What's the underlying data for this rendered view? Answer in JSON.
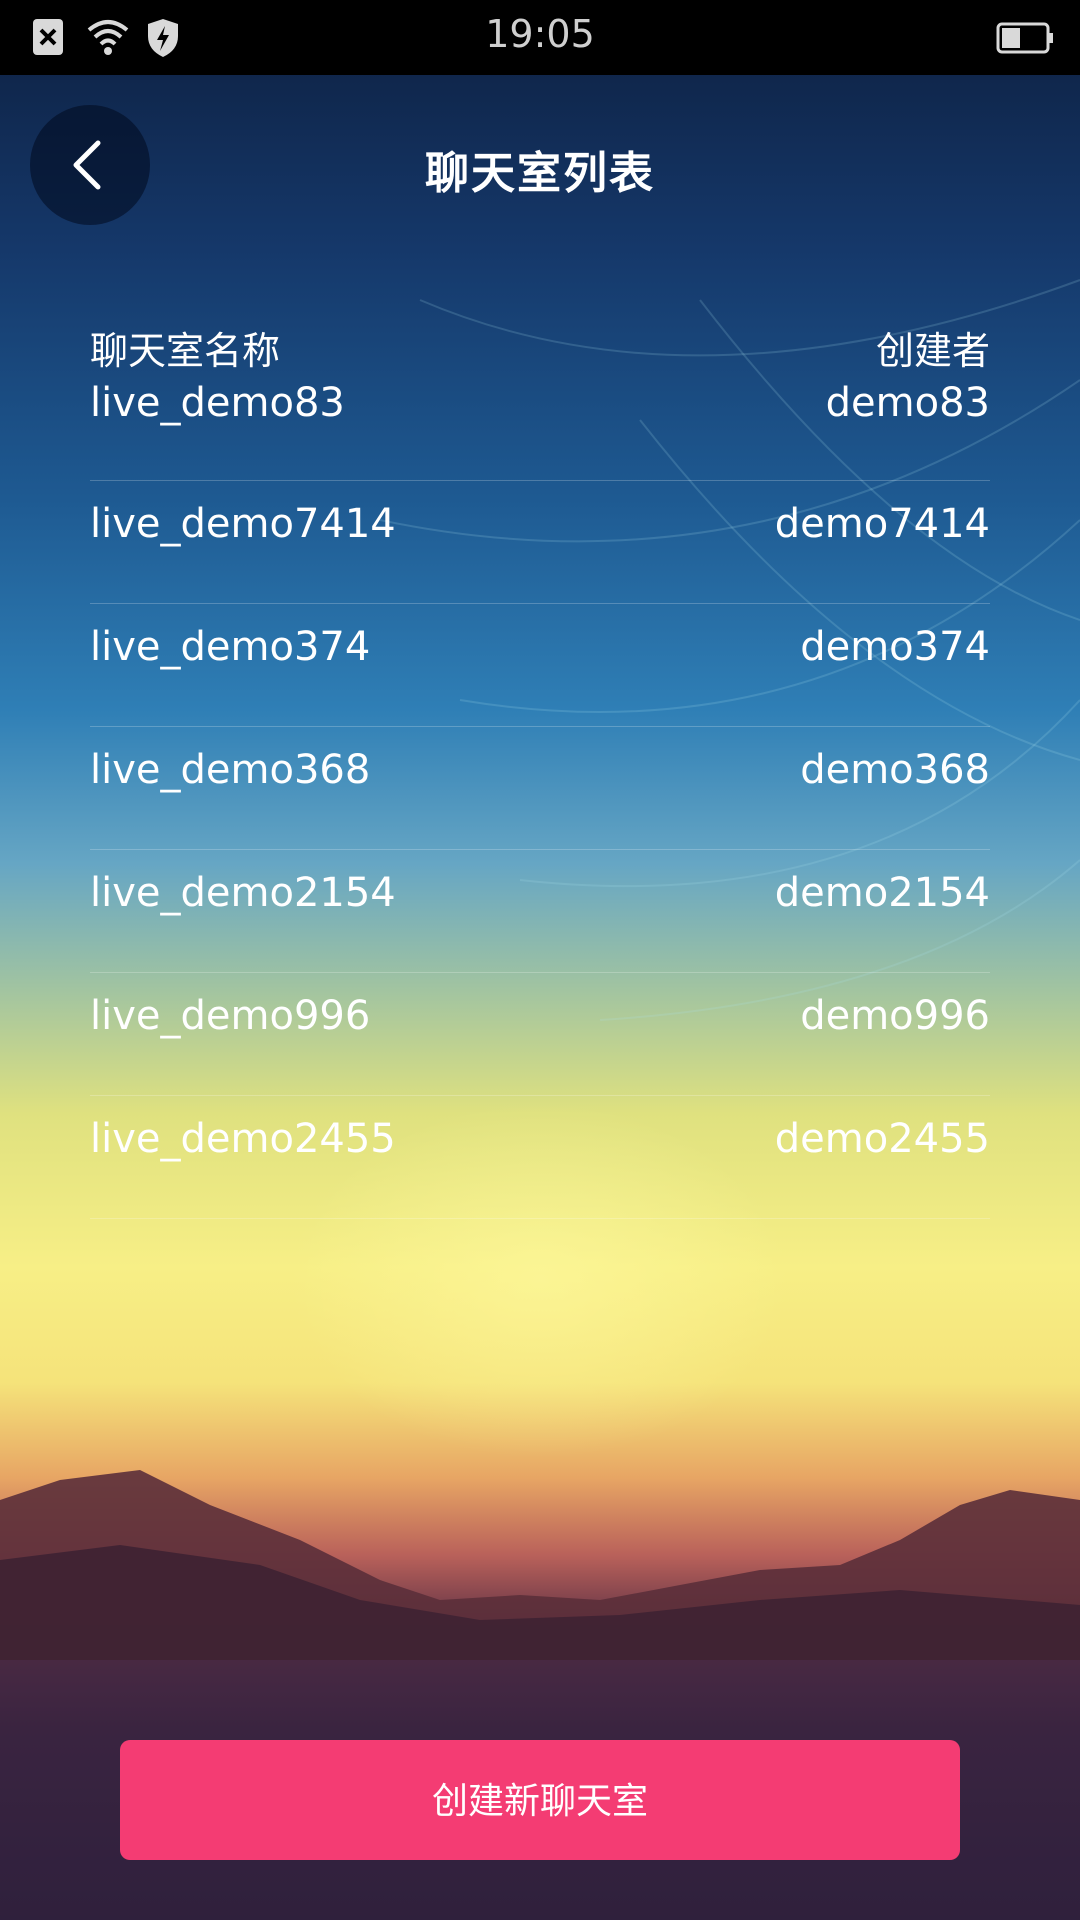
{
  "status_bar": {
    "time": "19:05",
    "icons": [
      "close-notification-icon",
      "wifi-icon",
      "shield-bolt-icon",
      "battery-icon"
    ]
  },
  "header": {
    "title": "聊天室列表",
    "back_icon": "chevron-left-icon"
  },
  "table": {
    "columns": [
      "聊天室名称",
      "创建者"
    ],
    "rows": [
      {
        "name": "live_demo83",
        "creator": "demo83"
      },
      {
        "name": "live_demo7414",
        "creator": "demo7414"
      },
      {
        "name": "live_demo374",
        "creator": "demo374"
      },
      {
        "name": "live_demo368",
        "creator": "demo368"
      },
      {
        "name": "live_demo2154",
        "creator": "demo2154"
      },
      {
        "name": "live_demo996",
        "creator": "demo996"
      },
      {
        "name": "live_demo2455",
        "creator": "demo2455"
      }
    ]
  },
  "footer": {
    "create_label": "创建新聊天室"
  },
  "colors": {
    "accent": "#f43c73",
    "status_bar": "#000000",
    "text": "#ffffff"
  }
}
